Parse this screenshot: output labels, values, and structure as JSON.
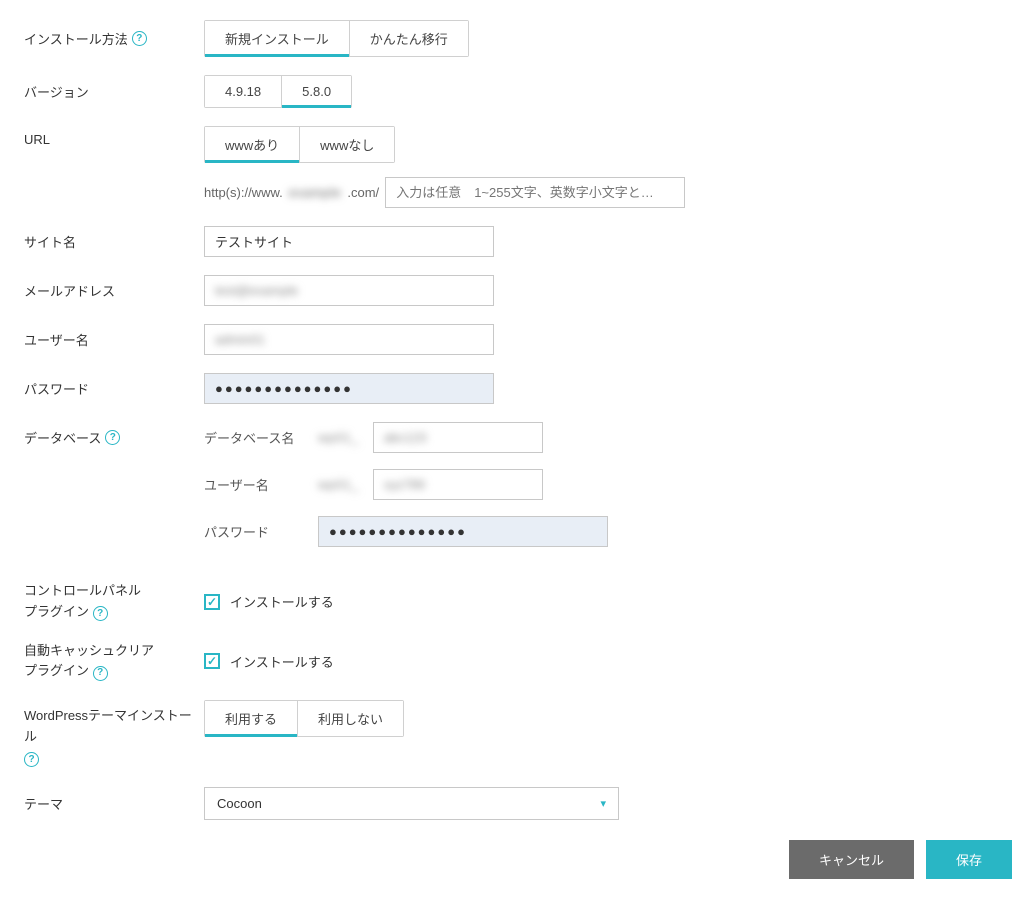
{
  "labels": {
    "install_method": "インストール方法",
    "version": "バージョン",
    "url": "URL",
    "site_name": "サイト名",
    "email": "メールアドレス",
    "username": "ユーザー名",
    "password": "パスワード",
    "database": "データベース",
    "db_name": "データベース名",
    "db_user": "ユーザー名",
    "db_pass": "パスワード",
    "cp_plugin_line1": "コントロールパネル",
    "cp_plugin_line2": "プラグイン",
    "auto_cache_line1": "自動キャッシュクリア",
    "auto_cache_line2": "プラグイン",
    "wp_theme_install": "WordPressテーマインストール",
    "theme": "テーマ"
  },
  "tabs": {
    "install_method": {
      "opt1": "新規インストール",
      "opt2": "かんたん移行"
    },
    "version": {
      "opt1": "4.9.18",
      "opt2": "5.8.0"
    },
    "www": {
      "opt1": "wwwあり",
      "opt2": "wwwなし"
    },
    "theme_use": {
      "opt1": "利用する",
      "opt2": "利用しない"
    }
  },
  "url": {
    "prefix": "http(s)://www.",
    "domain": "example",
    "suffix": ".com/",
    "placeholder": "入力は任意　1~255文字、英数字小文字と…"
  },
  "values": {
    "site_name": "テストサイト",
    "email": "test@example",
    "username": "admin01",
    "password": "●●●●●●●●●●●●●●",
    "db_name_prefix": "wp01_",
    "db_name_val": "abc123",
    "db_user_prefix": "wp01_",
    "db_user_val": "xyz789",
    "db_pass": "●●●●●●●●●●●●●●",
    "theme_selected": "Cocoon"
  },
  "checkbox": {
    "do_install": "インストールする"
  },
  "buttons": {
    "cancel": "キャンセル",
    "save": "保存"
  }
}
